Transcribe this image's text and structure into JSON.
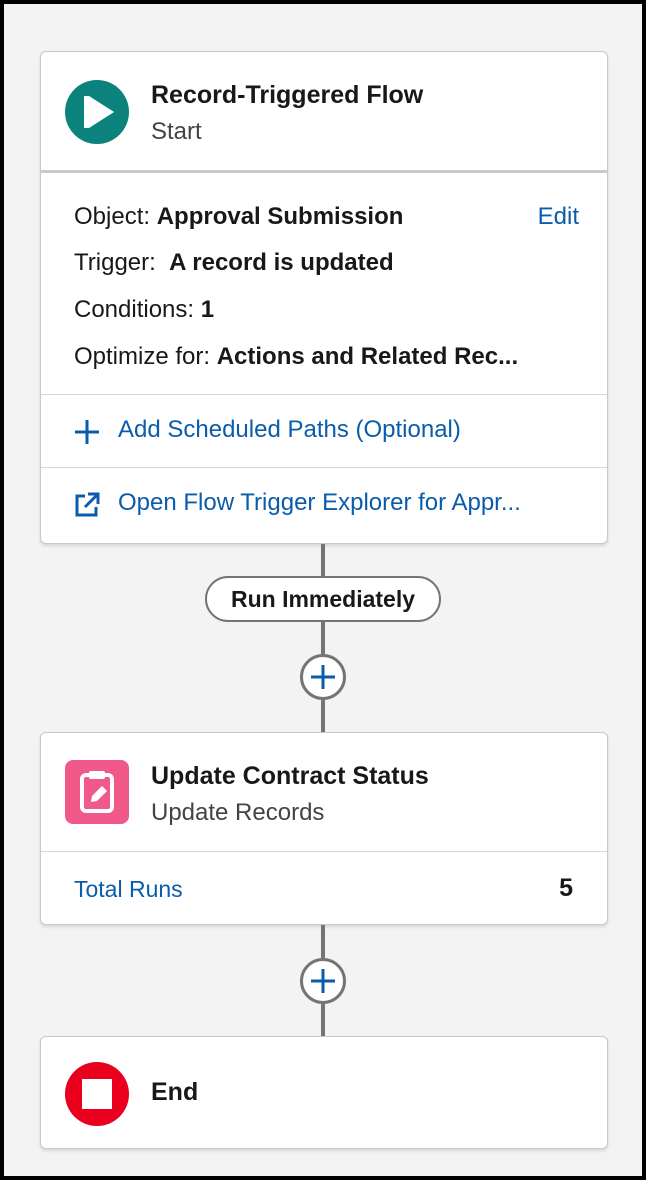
{
  "start_card": {
    "title": "Record-Triggered Flow",
    "subtitle": "Start",
    "icon": "play-icon",
    "icon_color": "#0b827c",
    "object_label": "Object:",
    "object_value": "Approval Submission",
    "edit_label": "Edit",
    "trigger_label": "Trigger:",
    "trigger_value": "A record is updated",
    "conditions_label": "Conditions:",
    "conditions_value": "1",
    "optimize_label": "Optimize for:",
    "optimize_value": "Actions and Related Rec...",
    "add_scheduled_paths": "Add Scheduled Paths (Optional)",
    "open_trigger_explorer": "Open Flow Trigger Explorer for Appr..."
  },
  "path_label": "Run Immediately",
  "update_card": {
    "title": "Update Contract Status",
    "subtitle": "Update Records",
    "icon": "clipboard-edit-icon",
    "icon_color": "#f0598a",
    "total_runs_label": "Total Runs",
    "total_runs_value": "5"
  },
  "end_card": {
    "title": "End",
    "icon": "stop-icon",
    "icon_color": "#ea001e"
  }
}
